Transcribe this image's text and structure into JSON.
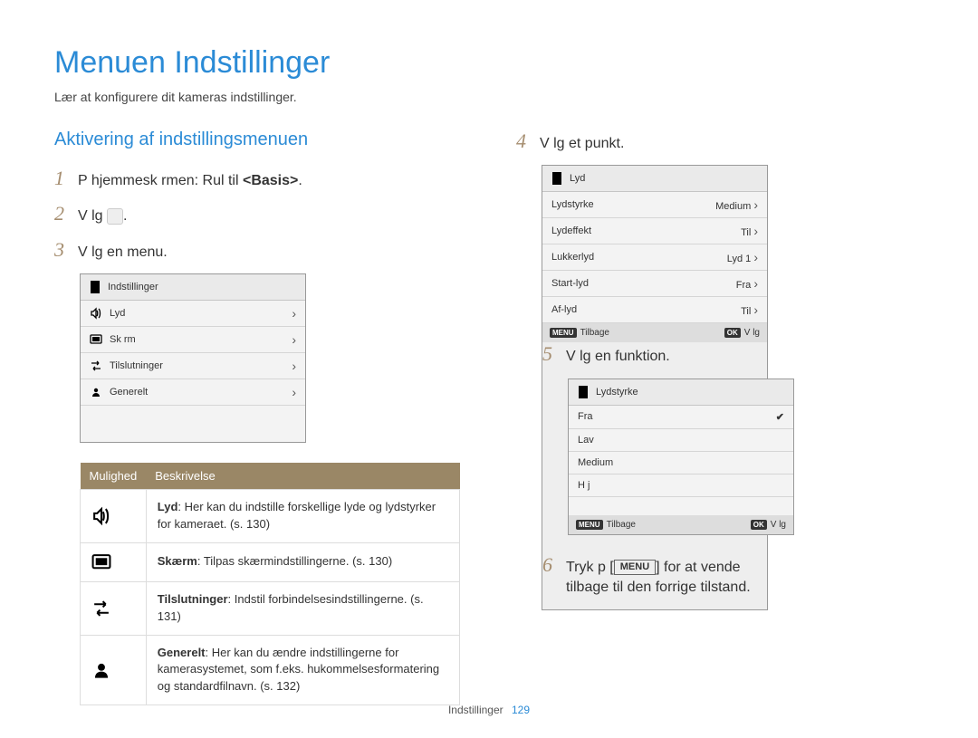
{
  "title": "Menuen Indstillinger",
  "subtitle": "Lær at konfigurere dit kameras indstillinger.",
  "section_title": "Aktivering af indstillingsmenuen",
  "steps_left": {
    "s1_pre": "P  hjemmesk rmen: Rul til ",
    "s1_bold": "<Basis>",
    "s1_post": ".",
    "s2": "V lg ",
    "s2_post": ".",
    "s3": "V lg en menu."
  },
  "screen1": {
    "title": "Indstillinger",
    "items": [
      {
        "label": "Lyd"
      },
      {
        "label": "Sk rm"
      },
      {
        "label": "Tilslutninger"
      },
      {
        "label": "Generelt"
      }
    ]
  },
  "desc_header": {
    "c1": "Mulighed",
    "c2": "Beskrivelse"
  },
  "desc_rows": [
    {
      "bold": "Lyd",
      "text": ": Her kan du indstille forskellige lyde og lydstyrker for kameraet. (s. 130)"
    },
    {
      "bold": "Skærm",
      "text": ": Tilpas skærmindstillingerne. (s. 130)"
    },
    {
      "bold": "Tilslutninger",
      "text": ": Indstil forbindelsesindstillingerne. (s. 131)"
    },
    {
      "bold": "Generelt",
      "text": ": Her kan du ændre indstillingerne for kamerasystemet, som f.eks. hukommelsesformatering og standardfilnavn. (s. 132)"
    }
  ],
  "steps_right": {
    "s4": "V lg et punkt.",
    "s5": "V lg en funktion.",
    "s6_pre": "Tryk p  [",
    "s6_menu": "MENU",
    "s6_post": "] for at vende tilbage til den forrige tilstand."
  },
  "screen2": {
    "title": "Lyd",
    "rows": [
      {
        "label": "Lydstyrke",
        "value": "Medium"
      },
      {
        "label": "Lydeffekt",
        "value": "Til"
      },
      {
        "label": "Lukkerlyd",
        "value": "Lyd 1"
      },
      {
        "label": "Start-lyd",
        "value": "Fra"
      },
      {
        "label": "Af-lyd",
        "value": "Til"
      }
    ],
    "footer_left": "Tilbage",
    "footer_right": "V lg",
    "badge_left": "MENU",
    "badge_right": "OK"
  },
  "screen3": {
    "title": "Lydstyrke",
    "rows": [
      {
        "label": "Fra",
        "checked": true
      },
      {
        "label": "Lav"
      },
      {
        "label": "Medium"
      },
      {
        "label": "H j"
      }
    ],
    "footer_left": "Tilbage",
    "footer_right": "V lg",
    "badge_left": "MENU",
    "badge_right": "OK"
  },
  "footer": {
    "section": "Indstillinger",
    "page": "129"
  }
}
